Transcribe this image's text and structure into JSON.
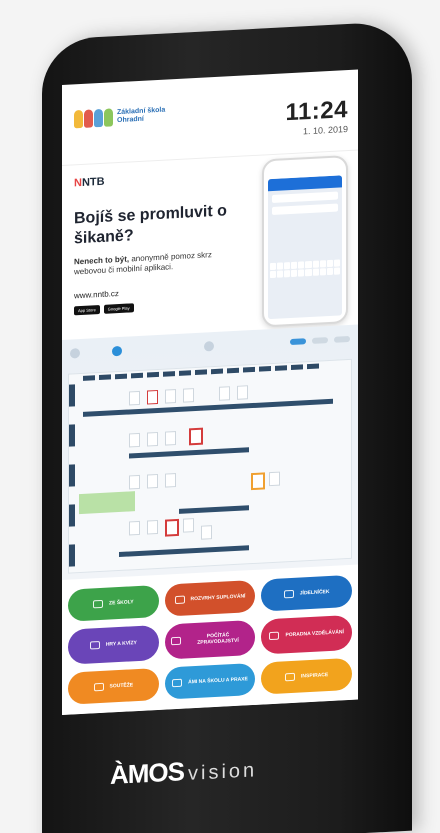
{
  "header": {
    "school_line1": "Základní škola",
    "school_line2": "Ohradní",
    "time": "11:24",
    "date": "1. 10. 2019"
  },
  "banner": {
    "logo_n": "N",
    "logo_rest": "NTB",
    "headline": "Bojíš se promluvit o šikaně?",
    "sub_bold": "Nenech to být,",
    "sub_rest": "anonymně pomoz skrz webovou či mobilní aplikaci.",
    "url": "www.nntb.cz",
    "store_apple": "App Store",
    "store_google": "Google Play"
  },
  "tiles": [
    {
      "label": "ZE ŠKOLY",
      "color": "#3da34a",
      "icon": "book-icon"
    },
    {
      "label": "ROZVRHY SUPLOVÁNÍ",
      "color": "#d2502b",
      "icon": "clock-icon"
    },
    {
      "label": "JÍDELNÍČEK",
      "color": "#1e6fc2",
      "icon": "dish-icon"
    },
    {
      "label": "HRY A KVÍZY",
      "color": "#6a45b8",
      "icon": "gamepad-icon"
    },
    {
      "label": "POČÍTÁČ ZPRAVODAJSTVÍ",
      "color": "#b2238a",
      "icon": "mic-icon"
    },
    {
      "label": "PORADNA VZDĚLÁVÁNÍ",
      "color": "#d12d55",
      "icon": "chat-icon"
    },
    {
      "label": "SOUTĚŽE",
      "color": "#f08a22",
      "icon": "trophy-icon"
    },
    {
      "label": "ÁMI NA ŠKOLU A PRAXE",
      "color": "#2e9ad8",
      "icon": "star-icon"
    },
    {
      "label": "INSPIRACE",
      "color": "#f2a31d",
      "icon": "bulb-icon"
    }
  ],
  "brand": {
    "amos": "ÀMOS",
    "vision": "vision"
  }
}
